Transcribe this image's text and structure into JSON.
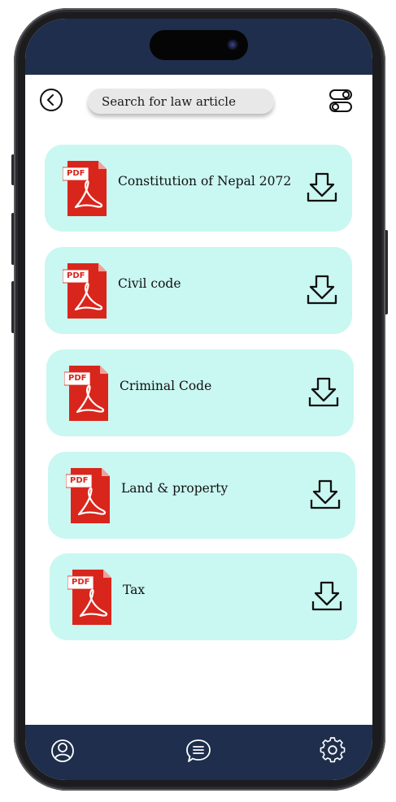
{
  "colors": {
    "bar_background": "#1f2e4c",
    "card_background": "#c9f7f1",
    "pdf_red": "#d9261c"
  },
  "header": {
    "back_icon": "chevron-left-circle-icon",
    "search": {
      "placeholder": "Search for law article"
    },
    "filter_icon": "toggle-switches-icon"
  },
  "documents": [
    {
      "title": "Constitution of Nepal 2072",
      "file_badge": "PDF",
      "action_icon": "download-icon"
    },
    {
      "title": "Civil code",
      "file_badge": "PDF",
      "action_icon": "download-icon"
    },
    {
      "title": "Criminal Code",
      "file_badge": "PDF",
      "action_icon": "download-icon"
    },
    {
      "title": "Land & property",
      "file_badge": "PDF",
      "action_icon": "download-icon"
    },
    {
      "title": "Tax",
      "file_badge": "PDF",
      "action_icon": "download-icon"
    }
  ],
  "bottom_nav": [
    {
      "icon": "profile-icon"
    },
    {
      "icon": "chat-menu-icon"
    },
    {
      "icon": "settings-gear-icon"
    }
  ]
}
